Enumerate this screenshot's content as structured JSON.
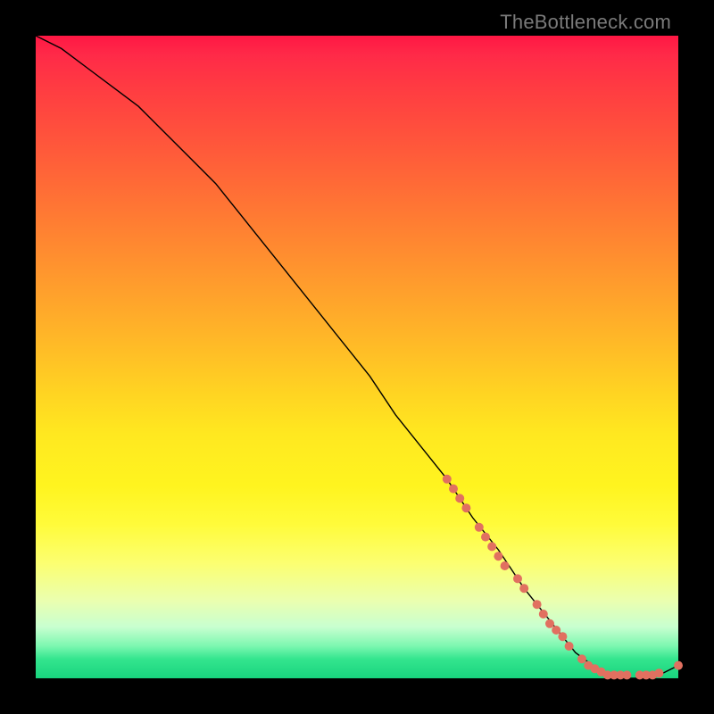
{
  "watermark": "TheBottleneck.com",
  "chart_data": {
    "type": "line",
    "title": "",
    "xlabel": "",
    "ylabel": "",
    "xlim": [
      0,
      100
    ],
    "ylim": [
      0,
      100
    ],
    "grid": false,
    "series": [
      {
        "name": "curve",
        "x": [
          0,
          4,
          8,
          12,
          16,
          20,
          24,
          28,
          32,
          36,
          40,
          44,
          48,
          52,
          56,
          60,
          64,
          68,
          72,
          76,
          80,
          84,
          88,
          92,
          96,
          100
        ],
        "values": [
          100,
          98,
          95,
          92,
          89,
          85,
          81,
          77,
          72,
          67,
          62,
          57,
          52,
          47,
          41,
          36,
          31,
          25,
          20,
          14,
          9,
          4,
          1,
          0,
          0,
          2
        ]
      }
    ],
    "markers": {
      "name": "scatter-points",
      "color": "#e17060",
      "points": [
        {
          "x": 64,
          "y": 31
        },
        {
          "x": 65,
          "y": 29.5
        },
        {
          "x": 66,
          "y": 28
        },
        {
          "x": 67,
          "y": 26.5
        },
        {
          "x": 69,
          "y": 23.5
        },
        {
          "x": 70,
          "y": 22
        },
        {
          "x": 71,
          "y": 20.5
        },
        {
          "x": 72,
          "y": 19
        },
        {
          "x": 73,
          "y": 17.5
        },
        {
          "x": 75,
          "y": 15.5
        },
        {
          "x": 76,
          "y": 14
        },
        {
          "x": 78,
          "y": 11.5
        },
        {
          "x": 79,
          "y": 10
        },
        {
          "x": 80,
          "y": 8.5
        },
        {
          "x": 81,
          "y": 7.5
        },
        {
          "x": 82,
          "y": 6.5
        },
        {
          "x": 83,
          "y": 5
        },
        {
          "x": 85,
          "y": 3
        },
        {
          "x": 86,
          "y": 2
        },
        {
          "x": 87,
          "y": 1.5
        },
        {
          "x": 88,
          "y": 1
        },
        {
          "x": 89,
          "y": 0.5
        },
        {
          "x": 90,
          "y": 0.5
        },
        {
          "x": 91,
          "y": 0.5
        },
        {
          "x": 92,
          "y": 0.5
        },
        {
          "x": 94,
          "y": 0.5
        },
        {
          "x": 95,
          "y": 0.5
        },
        {
          "x": 96,
          "y": 0.5
        },
        {
          "x": 97,
          "y": 0.8
        },
        {
          "x": 100,
          "y": 2
        }
      ]
    }
  }
}
